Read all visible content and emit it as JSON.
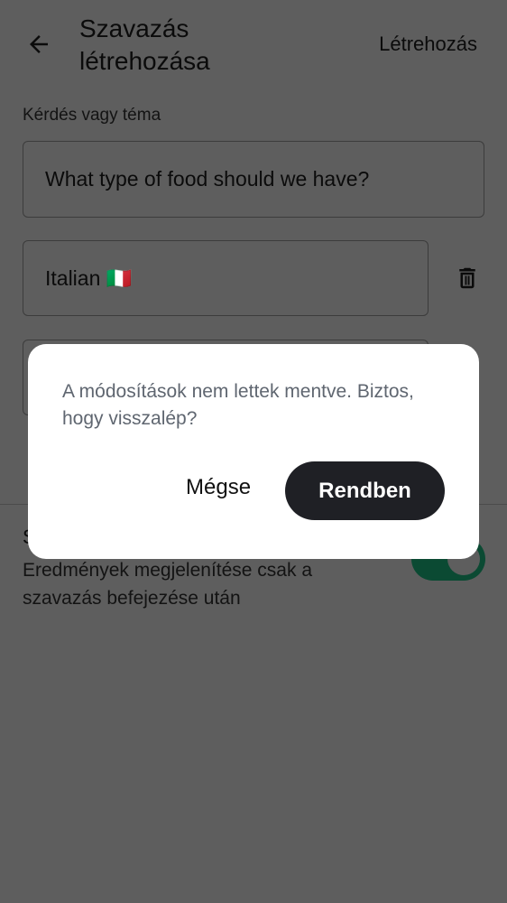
{
  "header": {
    "title": "Szavazás létrehozása",
    "create_label": "Létrehozás"
  },
  "form": {
    "question_label": "Kérdés vagy téma",
    "question_value": "What type of food should we have?",
    "options": [
      "Italian 🇮🇹",
      ""
    ]
  },
  "settings": {
    "section_title_visible": "S",
    "description": "Eredmények megjelenítése csak a szavazás befejezése után",
    "toggle_on": true
  },
  "dialog": {
    "message": "A módosítások nem lettek mentve. Biztos, hogy visszalép?",
    "cancel_label": "Mégse",
    "ok_label": "Rendben"
  }
}
